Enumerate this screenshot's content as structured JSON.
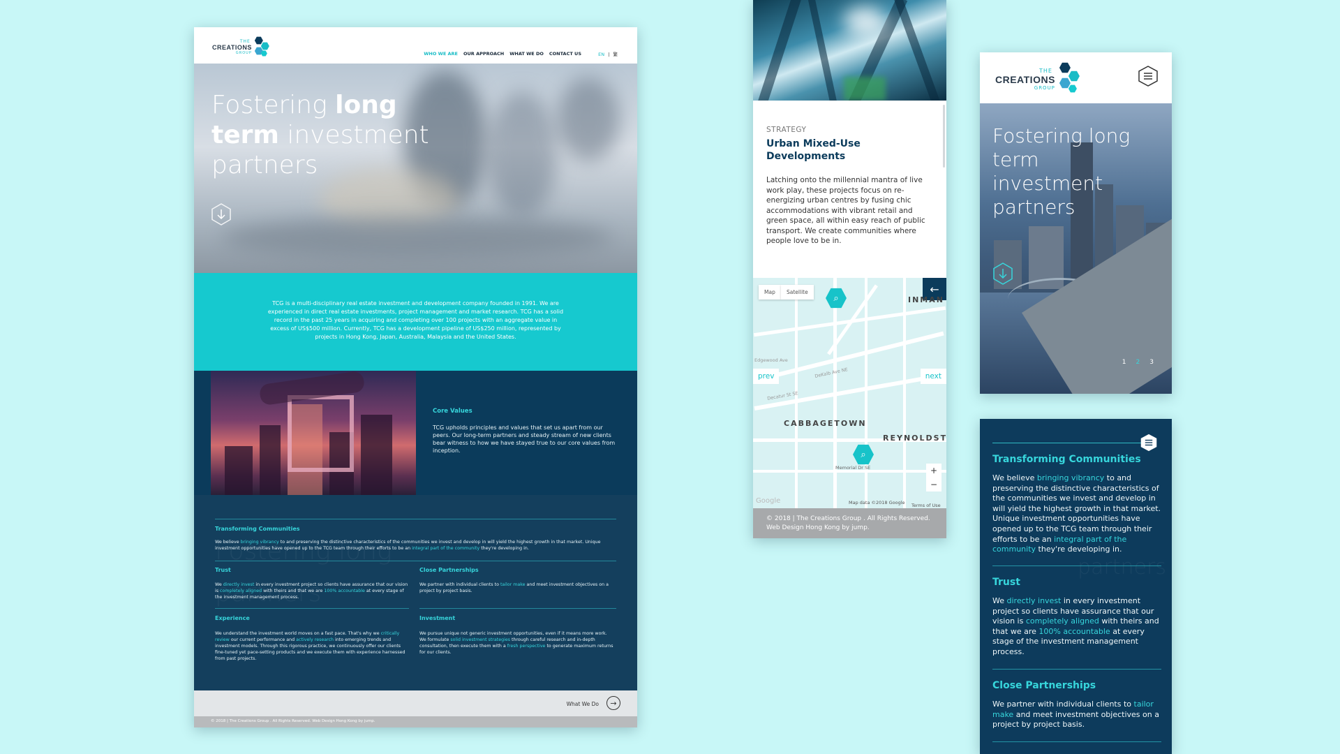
{
  "brand": {
    "the": "THE",
    "name": "CREATIONS",
    "group": "GROUP"
  },
  "desktop": {
    "nav": [
      "WHO WE ARE",
      "OUR APPROACH",
      "WHAT WE DO",
      "CONTACT US"
    ],
    "lang_en": "EN",
    "lang_sep": "|",
    "lang_zh": "繁",
    "hero_l1a": "Fostering ",
    "hero_l1b": "long",
    "hero_l2a": "term",
    "hero_l2b": " investment",
    "hero_l3": "partners",
    "about": "TCG is a multi-disciplinary real estate investment and development company founded in 1991. We are experienced in direct real estate investments, project management and market research. TCG has a solid record in the past 25 years in acquiring and completing over 100 projects with an aggregate value in excess of US$500 million. Currently, TCG has a development pipeline of US$250 million, represented by projects in Hong Kong, Japan, Australia, Malaysia and the United States.",
    "core_title": "Core Values",
    "core_text": "TCG upholds principles and values that set us apart from our peers. Our long-term partners and steady stream of new clients bear witness to how we have stayed true to our core values from inception.",
    "ghost1": "Fostering long",
    "ghost2": "partners",
    "values": {
      "tc_title": "Transforming Communities",
      "tc_a": "We believe ",
      "tc_b": "bringing vibrancy",
      "tc_c": " to and preserving the distinctive characteristics of the communities we invest and develop in will yield the highest growth in that market. Unique investment opportunities have opened up to the TCG team through their efforts to be an ",
      "tc_d": "integral part of the community",
      "tc_e": " they're developing in.",
      "trust_title": "Trust",
      "trust_a": "We ",
      "trust_b": "directly invest",
      "trust_c": " in every investment project so clients have assurance that our vision is ",
      "trust_d": "completely aligned",
      "trust_e": " with theirs and that we are ",
      "trust_f": "100% accountable",
      "trust_g": " at every stage of the investment management process.",
      "cp_title": "Close Partnerships",
      "cp_a": "We partner with individual clients to ",
      "cp_b": "tailor make",
      "cp_c": " and meet investment objectives on a project by project basis.",
      "exp_title": "Experience",
      "exp_a": "We understand the investment world moves on a fast pace. That's why we ",
      "exp_b": "critically review",
      "exp_c": " our current performance and ",
      "exp_d": "actively research",
      "exp_e": " into emerging trends and investment models. Through this rigorous practice, we continuously offer our clients fine-tuned yet pace-setting products and we execute them with experience harnessed from past projects.",
      "inv_title": "Investment",
      "inv_a": "We pursue unique not generic investment opportunities, even if it means more work. We formulate ",
      "inv_b": "solid investment strategies",
      "inv_c": " through careful research and in-depth consultation, then execute them with a ",
      "inv_d": "fresh perspective",
      "inv_e": " to generate maximum returns for our clients."
    },
    "next_label": "What We Do",
    "footer": "© 2018 | The Creations Group . All Rights Reserved. Web Design Hong Kong by jump."
  },
  "mobile_mid": {
    "kicker": "STRATEGY",
    "title": "Urban Mixed-Use Developments",
    "body": "Latching onto the millennial mantra of live work play, these projects focus on re-energizing urban centres by fusing chic accommodations with vibrant retail and green space, all within easy reach of public transport. We create communities where people love to be in.",
    "map_btn": "Map",
    "satellite_btn": "Satellite",
    "prev": "prev",
    "next": "next",
    "area1": "CABBAGETOWN",
    "area2": "REYNOLDSTO",
    "area3": "INMAN",
    "street1": "Memorial Dr SE",
    "street2": "DeKalb Ave NE",
    "street3": "Decatur St SE",
    "street4": "Edgewood Ave",
    "zoom_in": "+",
    "zoom_out": "−",
    "map_data": "Map data ©2018 Google",
    "terms": "Terms of Use",
    "google": "Google",
    "footer_l1": "© 2018 | The Creations Group . All Rights Reserved.",
    "footer_l2": "Web Design Hong Kong by jump."
  },
  "mobile_right_top": {
    "hero": "Fostering long term investment partners",
    "dots": [
      "1",
      "2",
      "3"
    ]
  },
  "mobile_right_bottom": {
    "tc_title": "Transforming Communities",
    "tc_a": "We believe ",
    "tc_b": "bringing vibrancy",
    "tc_c": " to and preserving the distinctive characteristics of the communities we invest and develop in will yield the highest growth in that market. Unique investment opportunities have opened up to the TCG team through their efforts to be an ",
    "tc_d": "integral part of the community",
    "tc_e": " they're developing in.",
    "trust_title": "Trust",
    "trust_a": "We ",
    "trust_b": "directly invest",
    "trust_c": " in every investment project so clients have assurance that our vision is ",
    "trust_d": "completely aligned",
    "trust_e": " with theirs and that we are ",
    "trust_f": "100% accountable",
    "trust_g": " at every stage of the investment management process.",
    "cp_title": "Close Partnerships",
    "cp_a": "We partner with individual clients to ",
    "cp_b": "tailor make",
    "cp_c": " and meet investment objectives on a project by project basis."
  },
  "icons": [
    "down-arrow-hex-icon",
    "arrow-right-circle-icon",
    "back-arrow-icon",
    "search-marker-icon",
    "hamburger-hex-icon"
  ],
  "colors": {
    "background": "#c8f7f7",
    "teal": "#16c9cf",
    "navy": "#0b3b5b",
    "accent_text": "#37d6dc"
  }
}
